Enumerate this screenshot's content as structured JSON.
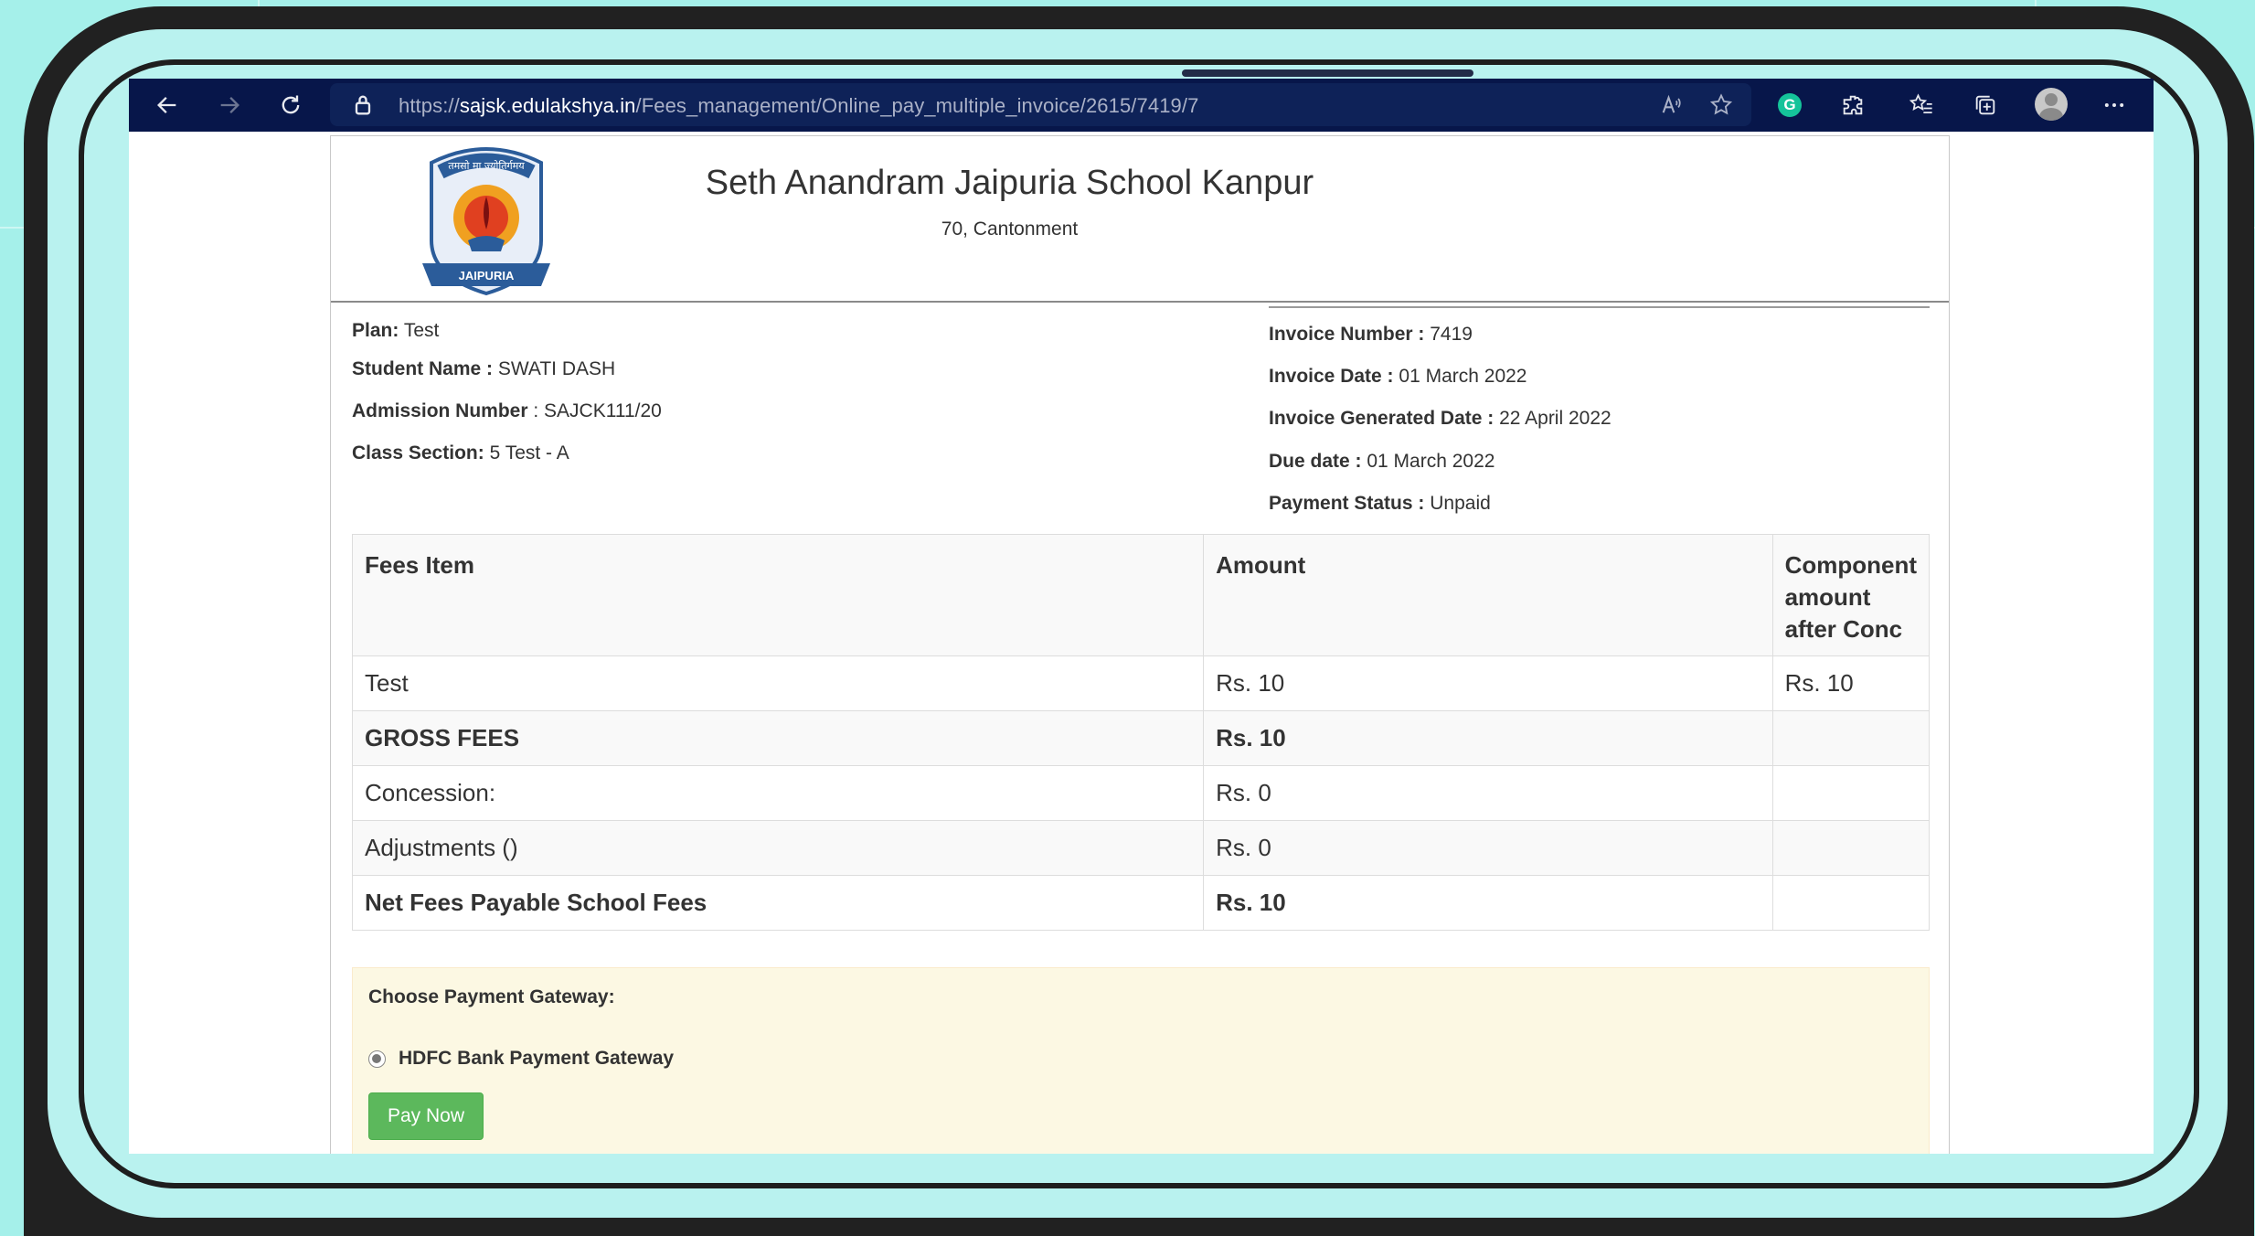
{
  "browser": {
    "url_scheme": "https://",
    "url_host": "sajsk.edulakshya.in",
    "url_path": "/Fees_management/Online_pay_multiple_invoice/2615/7419/7",
    "grammarly_letter": "G"
  },
  "school": {
    "name": "Seth Anandram Jaipuria School Kanpur",
    "address": "70, Cantonment",
    "logo_text_top": "तमसो मा ज्योतिर्गमय",
    "logo_text_bottom": "JAIPURIA"
  },
  "student": {
    "plan_label": "Plan:",
    "plan_value": "Test",
    "name_label": "Student Name :",
    "name_value": "SWATI DASH",
    "admission_label": "Admission Number",
    "admission_value": ": SAJCK111/20",
    "class_label": "Class Section:",
    "class_value": "5 Test - A"
  },
  "invoice": {
    "number_label": "Invoice Number :",
    "number_value": "7419",
    "date_label": "Invoice Date :",
    "date_value": "01 March 2022",
    "generated_label": "Invoice Generated Date :",
    "generated_value": "22 April 2022",
    "due_label": "Due date :",
    "due_value": "01 March 2022",
    "status_label": "Payment Status :",
    "status_value": "Unpaid"
  },
  "fees_table": {
    "headers": [
      "Fees Item",
      "Amount",
      "Component amount after Conc"
    ],
    "rows": [
      {
        "item": "Test",
        "amount": "Rs. 10",
        "after": "Rs. 10"
      },
      {
        "item": "GROSS FEES",
        "amount": "Rs. 10",
        "after": ""
      },
      {
        "item": "Concession:",
        "amount": "Rs. 0",
        "after": ""
      },
      {
        "item": "Adjustments ()",
        "amount": "Rs. 0",
        "after": ""
      },
      {
        "item": "Net Fees Payable School Fees",
        "amount": "Rs. 10",
        "after": ""
      }
    ]
  },
  "gateway": {
    "title": "Choose Payment Gateway:",
    "option": "HDFC Bank Payment Gateway",
    "selected": true,
    "pay_button": "Pay Now"
  },
  "colors": {
    "toolbar": "#07164a",
    "pay_button": "#5cb85c",
    "gateway_bg": "#fcf8e3"
  }
}
